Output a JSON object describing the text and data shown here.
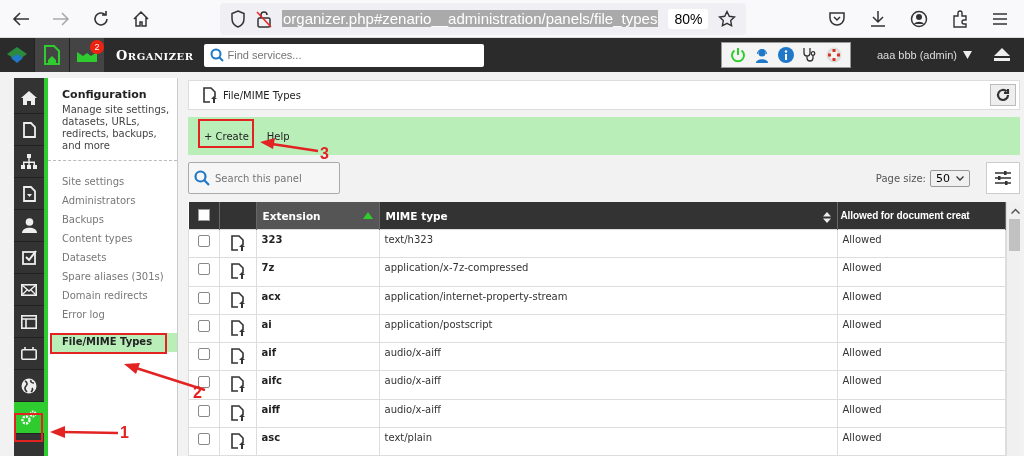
{
  "browser": {
    "url": "organizer.php#zenario__administration/panels/file_types",
    "zoom": "80%"
  },
  "topbar": {
    "title": "ORGANIZER",
    "notifications": "2",
    "search": {
      "placeholder": "Find services..."
    },
    "user": "aaa bbb (admin)"
  },
  "rail": [
    {
      "kind": "home",
      "selected": false
    },
    {
      "kind": "page",
      "selected": false
    },
    {
      "kind": "sitemap",
      "selected": false
    },
    {
      "kind": "download",
      "selected": false
    },
    {
      "kind": "user",
      "selected": false
    },
    {
      "kind": "check",
      "selected": false
    },
    {
      "kind": "mail",
      "selected": false
    },
    {
      "kind": "layout",
      "selected": false
    },
    {
      "kind": "calendar",
      "selected": false
    },
    {
      "kind": "globe",
      "selected": false
    },
    {
      "kind": "gears",
      "selected": true
    }
  ],
  "nav": {
    "title": "Configuration",
    "description": "Manage site settings, datasets, URLs, redirects, backups, and more",
    "items": [
      {
        "label": "Site settings",
        "selected": false
      },
      {
        "label": "Administrators",
        "selected": false
      },
      {
        "label": "Backups",
        "selected": false
      },
      {
        "label": "Content types",
        "selected": false
      },
      {
        "label": "Datasets",
        "selected": false
      },
      {
        "label": "Spare aliases (301s)",
        "selected": false
      },
      {
        "label": "Domain redirects",
        "selected": false
      },
      {
        "label": "Error log",
        "selected": false
      },
      {
        "label": "File/MIME Types",
        "selected": true
      }
    ]
  },
  "panel": {
    "title": "File/MIME Types",
    "toolbar": [
      "+ Create",
      "Help"
    ],
    "search": {
      "placeholder": "Search this panel"
    },
    "page_size_label": "Page size:",
    "page_size": "50"
  },
  "table": {
    "all_checked": false,
    "columns": [
      {
        "label": "Extension",
        "sorted": true
      },
      {
        "label": "MIME type",
        "sorted": false,
        "sortable": true
      },
      {
        "label": "Allowed for document creat",
        "sorted": false,
        "sortable": false
      }
    ],
    "rows": [
      {
        "checked": false,
        "cells": [
          "323",
          "text/h323",
          "Allowed"
        ]
      },
      {
        "checked": false,
        "cells": [
          "7z",
          "application/x-7z-compressed",
          "Allowed"
        ]
      },
      {
        "checked": false,
        "cells": [
          "acx",
          "application/internet-property-stream",
          "Allowed"
        ]
      },
      {
        "checked": false,
        "cells": [
          "ai",
          "application/postscript",
          "Allowed"
        ]
      },
      {
        "checked": false,
        "cells": [
          "aif",
          "audio/x-aiff",
          "Allowed"
        ]
      },
      {
        "checked": false,
        "cells": [
          "aifc",
          "audio/x-aiff",
          "Allowed"
        ]
      },
      {
        "checked": false,
        "cells": [
          "aiff",
          "audio/x-aiff",
          "Allowed"
        ]
      },
      {
        "checked": false,
        "cells": [
          "asc",
          "text/plain",
          "Allowed"
        ]
      }
    ]
  },
  "annotations": [
    {
      "number": "1"
    },
    {
      "number": "2"
    },
    {
      "number": "3"
    }
  ]
}
